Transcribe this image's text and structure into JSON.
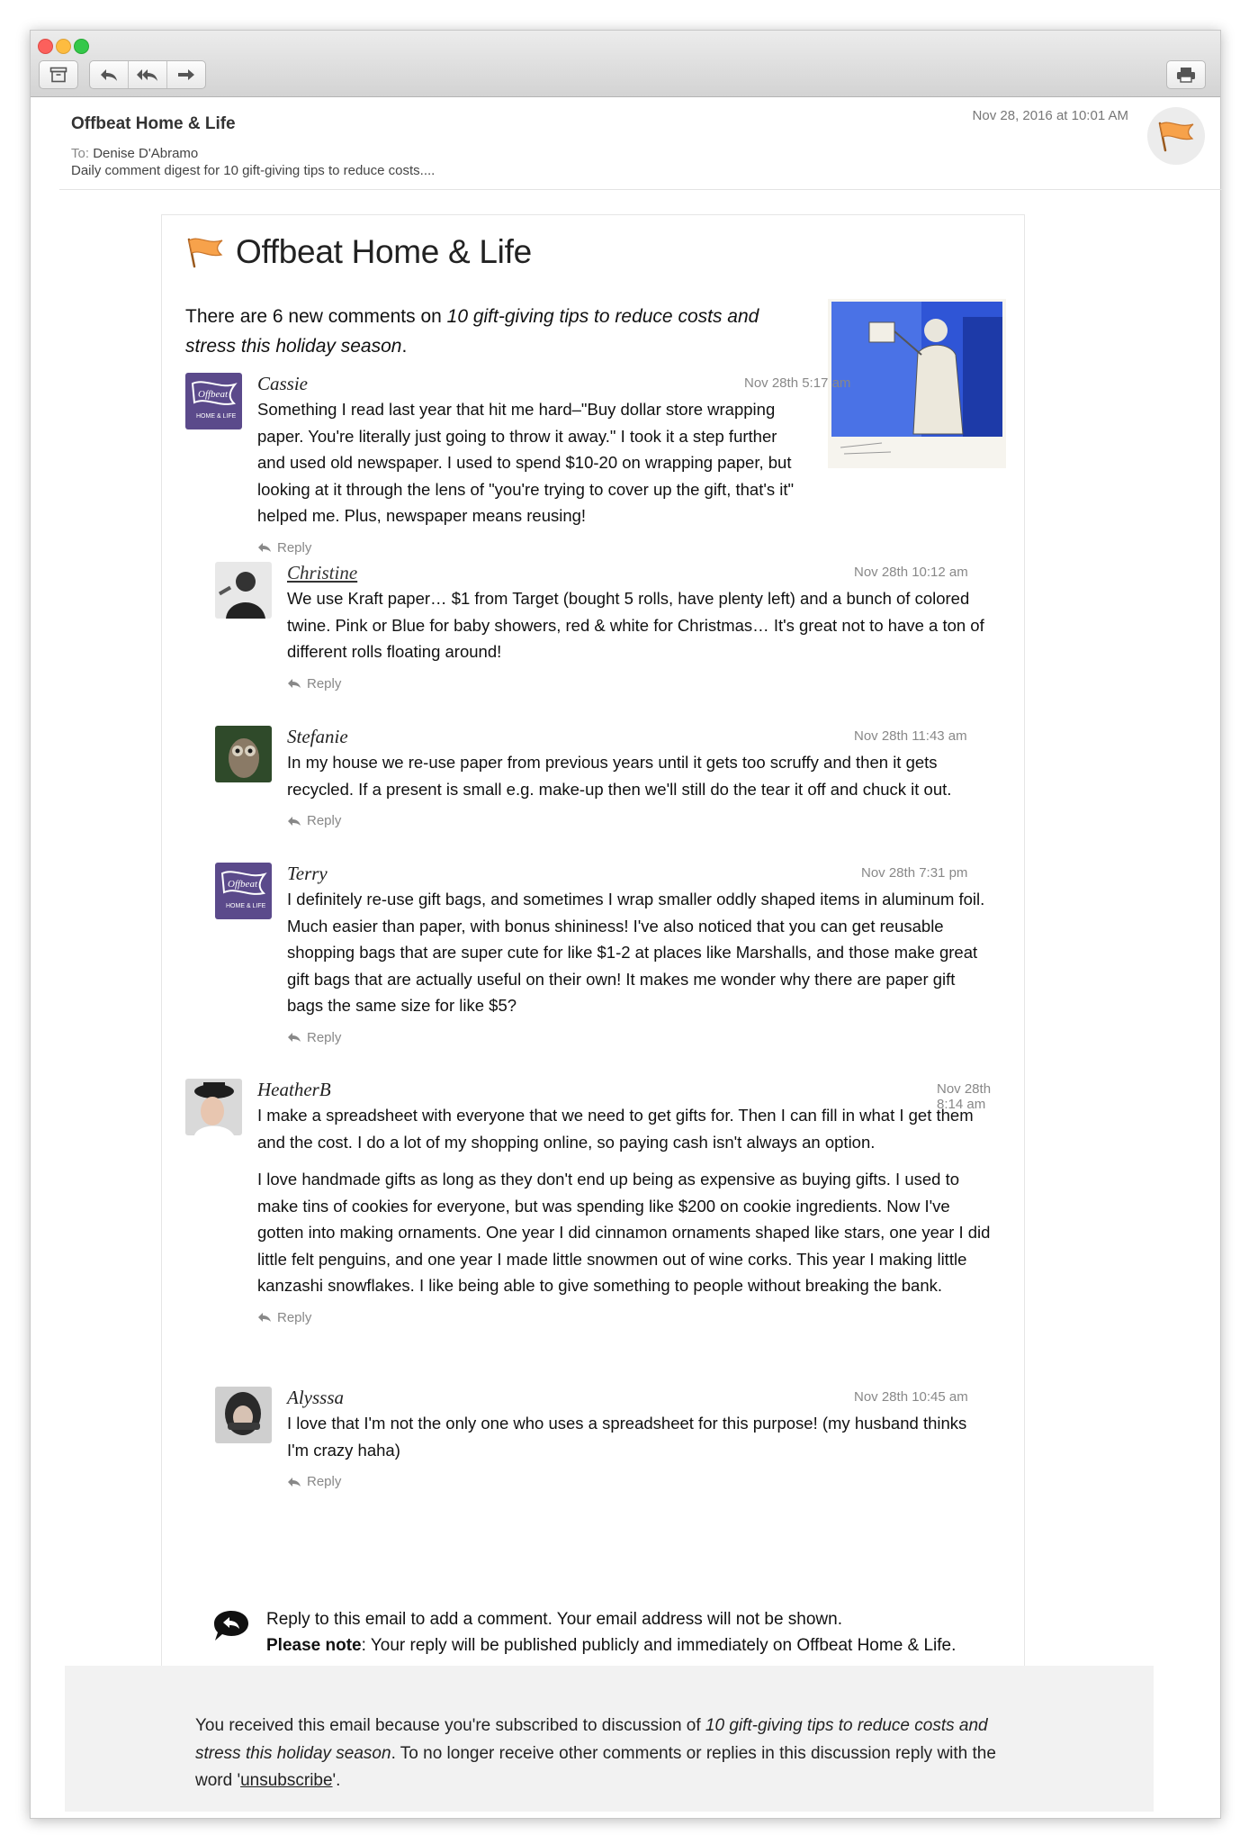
{
  "toolbar": {
    "archive_icon": "archive-box-icon",
    "reply_icon": "reply-arrow-icon",
    "reply_all_icon": "reply-all-arrow-icon",
    "forward_icon": "forward-arrow-icon",
    "print_icon": "printer-icon"
  },
  "message": {
    "from": "Offbeat Home & Life",
    "to_label": "To:",
    "to": "Denise D'Abramo",
    "subject": "Daily comment digest for 10 gift-giving tips to reduce costs....",
    "date": "Nov 28, 2016 at 10:01 AM"
  },
  "digest": {
    "brand_title": "Offbeat Home & Life",
    "intro_prefix": "There are 6 new comments on ",
    "intro_post": "10 gift-giving tips to reduce costs and stress this holiday season",
    "intro_suffix": ".",
    "reply_label": "Reply",
    "comments": [
      {
        "name": "Cassie",
        "date": "Nov 28th 5:17 am",
        "paragraphs": [
          "Something I read last year that hit me hard–\"Buy dollar store wrapping paper. You're literally just going to throw it away.\" I took it a step further and used old newspaper. I used to spend $10-20 on wrapping paper, but looking at it through the lens of \"you're trying to cover up the gift, that's it\" helped me. Plus, newspaper means reusing!"
        ]
      },
      {
        "name": "Christine",
        "date": "Nov 28th 10:12 am",
        "paragraphs": [
          "We use Kraft paper… $1 from Target (bought 5 rolls, have plenty left) and a bunch of colored twine. Pink or Blue for baby showers, red & white for Christmas… It's great not to have a ton of different rolls floating around!"
        ]
      },
      {
        "name": "Stefanie",
        "date": "Nov 28th 11:43 am",
        "paragraphs": [
          "In my house we re-use paper from previous years until it gets too scruffy and then it gets recycled. If a present is small e.g. make-up then we'll still do the tear it off and chuck it out."
        ]
      },
      {
        "name": "Terry",
        "date": "Nov 28th 7:31 pm",
        "paragraphs": [
          "I definitely re-use gift bags, and sometimes I wrap smaller oddly shaped items in aluminum foil. Much easier than paper, with bonus shininess! I've also noticed that you can get reusable shopping bags that are super cute for like $1-2 at places like Marshalls, and those make great gift bags that are actually useful on their own! It makes me wonder why there are paper gift bags the same size for like $5?"
        ]
      },
      {
        "name": "HeatherB",
        "date": "Nov 28th 8:14 am",
        "paragraphs": [
          "I make a spreadsheet with everyone that we need to get gifts for. Then I can fill in what I get them and the cost. I do a lot of my shopping online, so paying cash isn't always an option.",
          "I love handmade gifts as long as they don't end up being as expensive as buying gifts. I used to make tins of cookies for everyone, but was spending like $200 on cookie ingredients. Now I've gotten into making ornaments. One year I did cinnamon ornaments shaped like stars, one year I did little felt penguins, and one year I made little snowmen out of wine corks. This year I making little kanzashi snowflakes. I like being able to give something to people without breaking the bank."
        ]
      },
      {
        "name": "Alysssa",
        "date": "Nov 28th 10:45 am",
        "paragraphs": [
          "I love that I'm not the only one who uses a spreadsheet for this purpose! (my husband thinks I'm crazy haha)"
        ]
      }
    ],
    "note_line1": "Reply to this email to add a comment. Your email address will not be shown.",
    "note_bold": "Please note",
    "note_line2": ": Your reply will be published publicly and immediately on Offbeat Home & Life."
  },
  "footer": {
    "prefix": "You received this email because you're subscribed to discussion of ",
    "post": "10 gift-giving tips to reduce costs and stress this holiday season",
    "middle": ". To no longer receive other comments or replies in this discussion reply with the word '",
    "link": "unsubscribe",
    "suffix": "'."
  },
  "colors": {
    "flag_orange": "#f7a24b",
    "brand_purple": "#5b4a8b",
    "close_red": "#fc605c",
    "minimize_yellow": "#fdbc40",
    "zoom_green": "#34c84a"
  }
}
